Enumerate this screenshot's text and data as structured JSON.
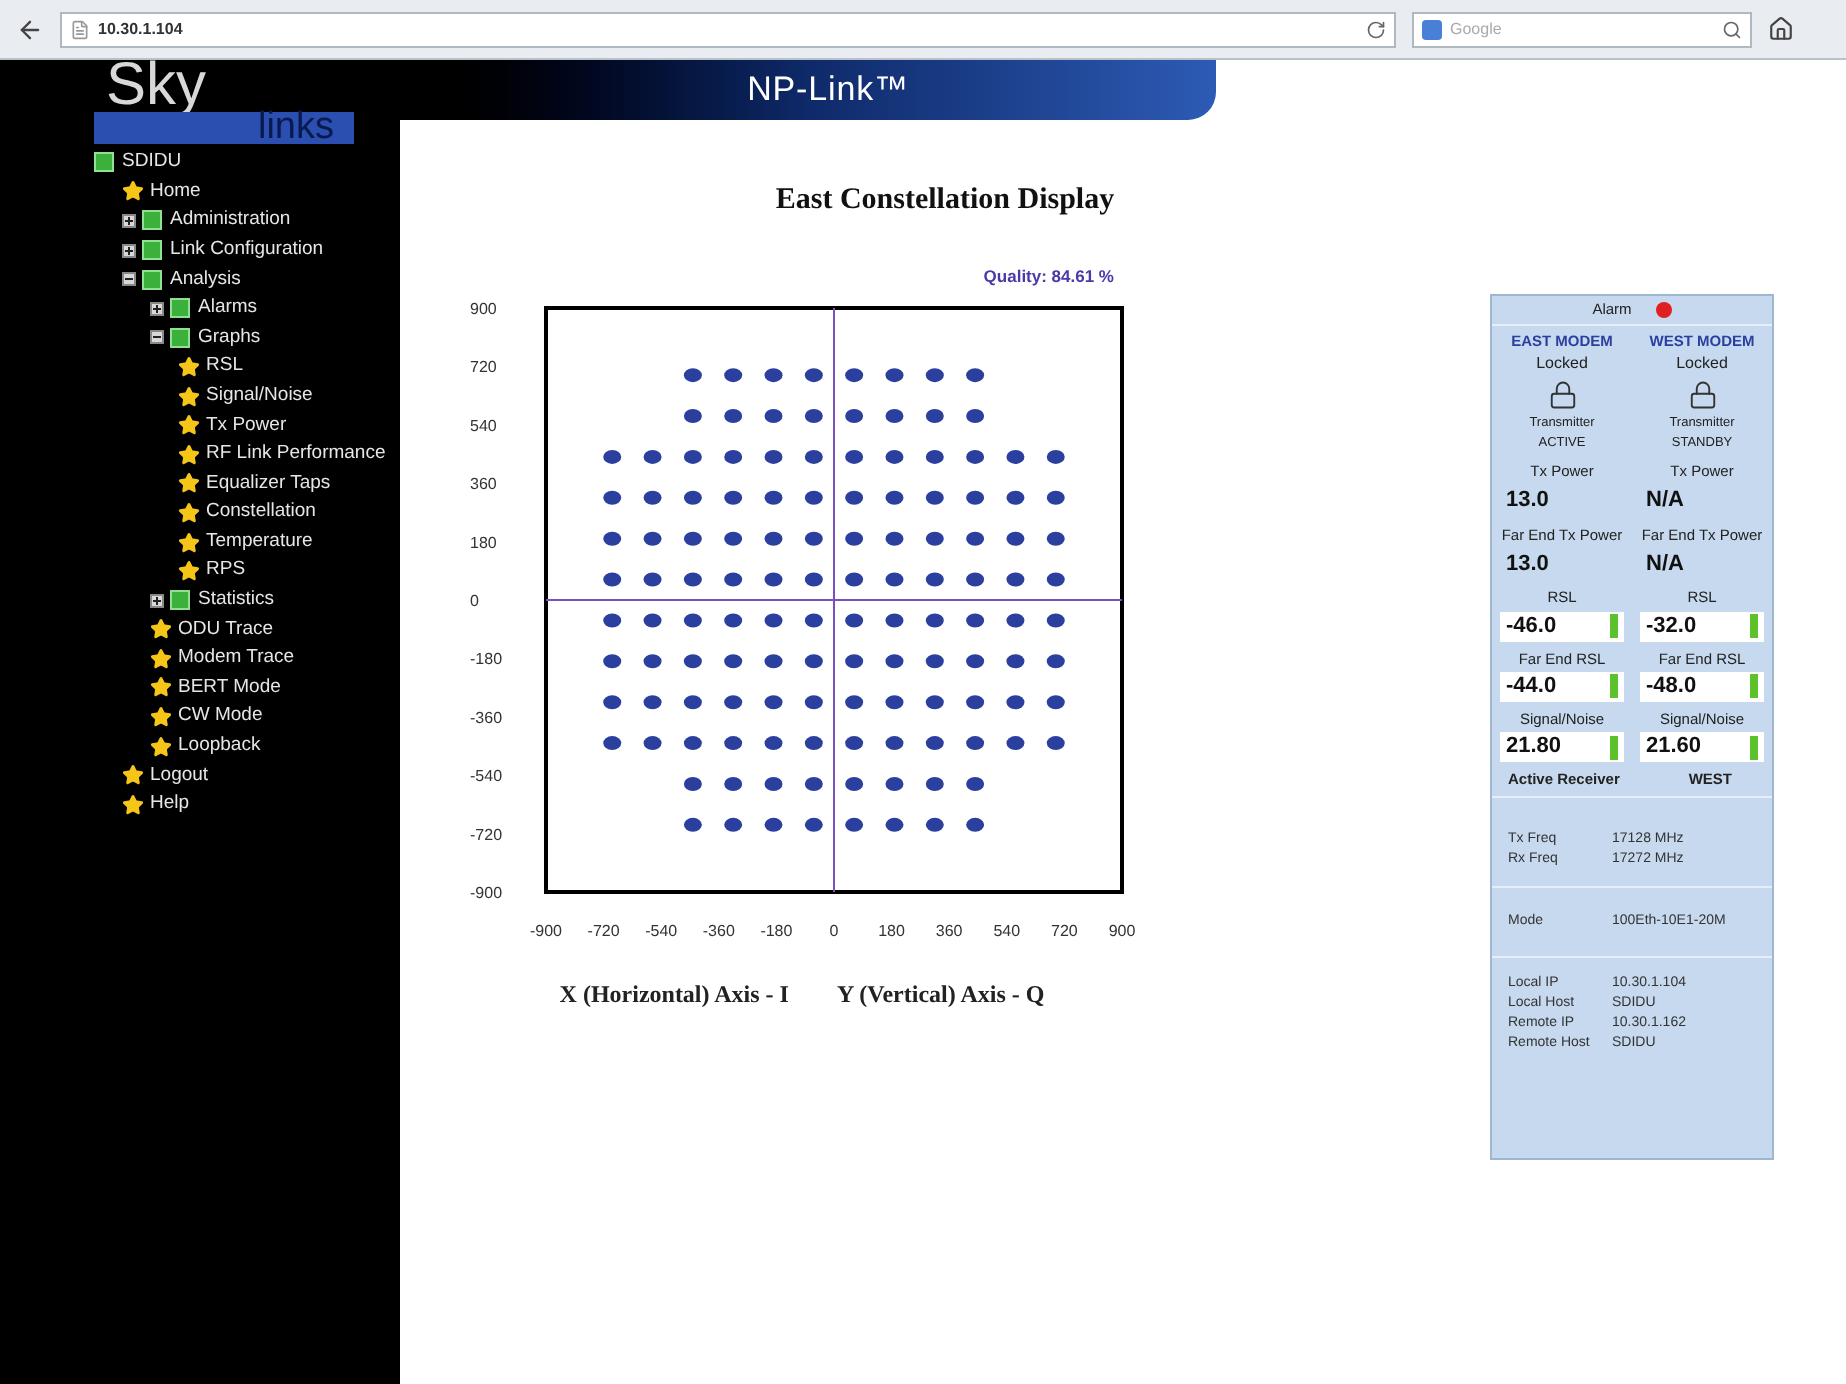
{
  "browser": {
    "address": "10.30.1.104",
    "search_placeholder": "Google"
  },
  "logo": {
    "top": "Sky",
    "bottom": "links"
  },
  "header": {
    "title": "NP-Link™"
  },
  "sidebar": {
    "items": [
      {
        "label": "SDIDU",
        "kind": "folder",
        "children": [
          {
            "label": "Home",
            "kind": "page"
          },
          {
            "label": "Administration",
            "kind": "folder",
            "expanded": false
          },
          {
            "label": "Link Configuration",
            "kind": "folder",
            "expanded": false
          },
          {
            "label": "Analysis",
            "kind": "folder",
            "expanded": true,
            "children": [
              {
                "label": "Alarms",
                "kind": "folder",
                "expanded": false
              },
              {
                "label": "Graphs",
                "kind": "folder",
                "expanded": true,
                "children": [
                  {
                    "label": "RSL",
                    "kind": "page"
                  },
                  {
                    "label": "Signal/Noise",
                    "kind": "page"
                  },
                  {
                    "label": "Tx Power",
                    "kind": "page"
                  },
                  {
                    "label": "RF Link Performance",
                    "kind": "page"
                  },
                  {
                    "label": "Equalizer Taps",
                    "kind": "page"
                  },
                  {
                    "label": "Constellation",
                    "kind": "page"
                  },
                  {
                    "label": "Temperature",
                    "kind": "page"
                  },
                  {
                    "label": "RPS",
                    "kind": "page"
                  }
                ]
              },
              {
                "label": "Statistics",
                "kind": "folder",
                "expanded": false
              },
              {
                "label": "ODU Trace",
                "kind": "page"
              },
              {
                "label": "Modem Trace",
                "kind": "page"
              },
              {
                "label": "BERT Mode",
                "kind": "page"
              },
              {
                "label": "CW Mode",
                "kind": "page"
              },
              {
                "label": "Loopback",
                "kind": "page"
              }
            ]
          },
          {
            "label": "Logout",
            "kind": "page"
          },
          {
            "label": "Help",
            "kind": "page"
          }
        ]
      }
    ]
  },
  "main": {
    "title": "East Constellation Display",
    "quality": "Quality: 84.61 %",
    "axis_captions": [
      "X (Horizontal) Axis - I",
      "Y (Vertical) Axis - Q"
    ],
    "chart_data": {
      "type": "scatter",
      "xlim": [
        -900,
        900
      ],
      "ylim": [
        -900,
        900
      ],
      "xticks": [
        -900,
        -720,
        -540,
        -360,
        -180,
        0,
        180,
        360,
        540,
        720,
        900
      ],
      "yticks": [
        900,
        720,
        540,
        360,
        180,
        0,
        -180,
        -360,
        -540,
        -720,
        -900
      ],
      "x": [
        -441,
        -315,
        -189,
        -63,
        63,
        189,
        315,
        441,
        -441,
        -315,
        -189,
        -63,
        63,
        189,
        315,
        441,
        -693,
        -567,
        -441,
        -315,
        -189,
        -63,
        63,
        189,
        315,
        441,
        567,
        693,
        -693,
        -567,
        -441,
        -315,
        -189,
        -63,
        63,
        189,
        315,
        441,
        567,
        693,
        -693,
        -567,
        -441,
        -315,
        -189,
        -63,
        63,
        189,
        315,
        441,
        567,
        693,
        -693,
        -567,
        -441,
        -315,
        -189,
        -63,
        63,
        189,
        315,
        441,
        567,
        693,
        -693,
        -567,
        -441,
        -315,
        -189,
        -63,
        63,
        189,
        315,
        441,
        567,
        693,
        -693,
        -567,
        -441,
        -315,
        -189,
        -63,
        63,
        189,
        315,
        441,
        567,
        693,
        -693,
        -567,
        -441,
        -315,
        -189,
        -63,
        63,
        189,
        315,
        441,
        567,
        693,
        -693,
        -567,
        -441,
        -315,
        -189,
        -63,
        63,
        189,
        315,
        441,
        567,
        693,
        -441,
        -315,
        -189,
        -63,
        63,
        189,
        315,
        441,
        -441,
        -315,
        -189,
        -63,
        63,
        189,
        315,
        441
      ],
      "series": [
        {
          "color": "#2b3f9e",
          "values": [
            693,
            693,
            693,
            693,
            693,
            693,
            693,
            693,
            567,
            567,
            567,
            567,
            567,
            567,
            567,
            567,
            441,
            441,
            441,
            441,
            441,
            441,
            441,
            441,
            441,
            441,
            441,
            441,
            315,
            315,
            315,
            315,
            315,
            315,
            315,
            315,
            315,
            315,
            315,
            315,
            189,
            189,
            189,
            189,
            189,
            189,
            189,
            189,
            189,
            189,
            189,
            189,
            63,
            63,
            63,
            63,
            63,
            63,
            63,
            63,
            63,
            63,
            63,
            63,
            -63,
            -63,
            -63,
            -63,
            -63,
            -63,
            -63,
            -63,
            -63,
            -63,
            -63,
            -63,
            -189,
            -189,
            -189,
            -189,
            -189,
            -189,
            -189,
            -189,
            -189,
            -189,
            -189,
            -189,
            -315,
            -315,
            -315,
            -315,
            -315,
            -315,
            -315,
            -315,
            -315,
            -315,
            -315,
            -315,
            -441,
            -441,
            -441,
            -441,
            -441,
            -441,
            -441,
            -441,
            -441,
            -441,
            -441,
            -441,
            -567,
            -567,
            -567,
            -567,
            -567,
            -567,
            -567,
            -567,
            -693,
            -693,
            -693,
            -693,
            -693,
            -693,
            -693,
            -693
          ]
        }
      ]
    }
  },
  "status_panel": {
    "alarm_label": "Alarm",
    "alarm_on": true,
    "modems": [
      {
        "name": "EAST MODEM",
        "lock_status": "Locked",
        "transmitter_label": "Transmitter",
        "transmitter_state": "ACTIVE",
        "fields": [
          {
            "kind": "value",
            "label": "Tx Power",
            "value": "13.0"
          },
          {
            "kind": "value",
            "label": "Far End Tx Power",
            "value": "13.0"
          },
          {
            "kind": "meter",
            "label": "RSL",
            "value": "-46.0",
            "level": 1
          },
          {
            "kind": "meter",
            "label": "Far End RSL",
            "value": "-44.0",
            "level": 1
          },
          {
            "kind": "meter",
            "label": "Signal/Noise",
            "value": "21.80",
            "level": 1
          }
        ]
      },
      {
        "name": "WEST MODEM",
        "lock_status": "Locked",
        "transmitter_label": "Transmitter",
        "transmitter_state": "STANDBY",
        "fields": [
          {
            "kind": "value",
            "label": "Tx Power",
            "value": "N/A"
          },
          {
            "kind": "value",
            "label": "Far End Tx Power",
            "value": "N/A"
          },
          {
            "kind": "meter",
            "label": "RSL",
            "value": "-32.0",
            "level": 1
          },
          {
            "kind": "meter",
            "label": "Far End RSL",
            "value": "-48.0",
            "level": 1
          },
          {
            "kind": "meter",
            "label": "Signal/Noise",
            "value": "21.60",
            "level": 1
          }
        ]
      }
    ],
    "active_receiver": {
      "label": "Active Receiver",
      "value": "WEST"
    },
    "frequencies": [
      {
        "label": "Tx Freq",
        "value": "17128 MHz"
      },
      {
        "label": "Rx Freq",
        "value": "17272 MHz"
      }
    ],
    "mode": {
      "label": "Mode",
      "value": "100Eth-10E1-20M"
    },
    "hosts": [
      {
        "label": "Local IP",
        "value": "10.30.1.104"
      },
      {
        "label": "Local Host",
        "value": "SDIDU"
      },
      {
        "label": "Remote IP",
        "value": "10.30.1.162"
      },
      {
        "label": "Remote Host",
        "value": "SDIDU"
      }
    ]
  }
}
